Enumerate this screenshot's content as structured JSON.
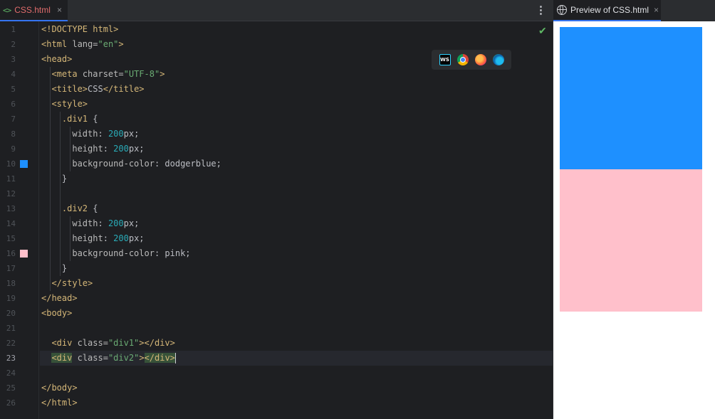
{
  "editor": {
    "tab": {
      "icon": "html-file-icon",
      "icon_glyph": "<>",
      "label": "CSS.html",
      "close": "×"
    },
    "menu_glyph": "⋮",
    "check_glyph": "✔",
    "current_line": 23,
    "lines": [
      {
        "n": "1",
        "code": [
          {
            "t": "<!DOCTYPE ",
            "c": "tag"
          },
          {
            "t": "html",
            "c": "tag"
          },
          {
            "t": ">",
            "c": "tag"
          }
        ]
      },
      {
        "n": "2",
        "code": [
          {
            "t": "<html ",
            "c": "tag"
          },
          {
            "t": "lang",
            "c": "attr"
          },
          {
            "t": "=",
            "c": "attr"
          },
          {
            "t": "\"en\"",
            "c": "str"
          },
          {
            "t": ">",
            "c": "tag"
          }
        ]
      },
      {
        "n": "3",
        "code": [
          {
            "t": "<head>",
            "c": "tag"
          }
        ]
      },
      {
        "n": "4",
        "code": [
          {
            "t": "  "
          },
          {
            "t": "<meta ",
            "c": "tag"
          },
          {
            "t": "charset",
            "c": "attr"
          },
          {
            "t": "=",
            "c": "attr"
          },
          {
            "t": "\"UTF-8\"",
            "c": "str"
          },
          {
            "t": ">",
            "c": "tag"
          }
        ]
      },
      {
        "n": "5",
        "code": [
          {
            "t": "  "
          },
          {
            "t": "<title>",
            "c": "tag"
          },
          {
            "t": "CSS"
          },
          {
            "t": "</title>",
            "c": "tag"
          }
        ]
      },
      {
        "n": "6",
        "code": [
          {
            "t": "  "
          },
          {
            "t": "<style>",
            "c": "tag"
          }
        ]
      },
      {
        "n": "7",
        "code": [
          {
            "t": "    "
          },
          {
            "t": ".div1",
            "c": "sel"
          },
          {
            "t": " {"
          }
        ]
      },
      {
        "n": "8",
        "code": [
          {
            "t": "      "
          },
          {
            "t": "width",
            "c": "prop"
          },
          {
            "t": ": "
          },
          {
            "t": "200",
            "c": "num"
          },
          {
            "t": "px;"
          }
        ]
      },
      {
        "n": "9",
        "code": [
          {
            "t": "      "
          },
          {
            "t": "height",
            "c": "prop"
          },
          {
            "t": ": "
          },
          {
            "t": "200",
            "c": "num"
          },
          {
            "t": "px;"
          }
        ]
      },
      {
        "n": "10",
        "code": [
          {
            "t": "      "
          },
          {
            "t": "background-color",
            "c": "prop"
          },
          {
            "t": ": dodgerblue;"
          }
        ],
        "swatch": "#1e90ff"
      },
      {
        "n": "11",
        "code": [
          {
            "t": "    }"
          }
        ]
      },
      {
        "n": "12",
        "code": []
      },
      {
        "n": "13",
        "code": [
          {
            "t": "    "
          },
          {
            "t": ".div2",
            "c": "sel"
          },
          {
            "t": " {"
          }
        ]
      },
      {
        "n": "14",
        "code": [
          {
            "t": "      "
          },
          {
            "t": "width",
            "c": "prop"
          },
          {
            "t": ": "
          },
          {
            "t": "200",
            "c": "num"
          },
          {
            "t": "px;"
          }
        ]
      },
      {
        "n": "15",
        "code": [
          {
            "t": "      "
          },
          {
            "t": "height",
            "c": "prop"
          },
          {
            "t": ": "
          },
          {
            "t": "200",
            "c": "num"
          },
          {
            "t": "px;"
          }
        ]
      },
      {
        "n": "16",
        "code": [
          {
            "t": "      "
          },
          {
            "t": "background-color",
            "c": "prop"
          },
          {
            "t": ": pink;"
          }
        ],
        "swatch": "#ffc0cb"
      },
      {
        "n": "17",
        "code": [
          {
            "t": "    }"
          }
        ]
      },
      {
        "n": "18",
        "code": [
          {
            "t": "  "
          },
          {
            "t": "</style>",
            "c": "tag"
          }
        ]
      },
      {
        "n": "19",
        "code": [
          {
            "t": "</head>",
            "c": "tag"
          }
        ]
      },
      {
        "n": "20",
        "code": [
          {
            "t": "<body>",
            "c": "tag"
          }
        ]
      },
      {
        "n": "21",
        "code": []
      },
      {
        "n": "22",
        "code": [
          {
            "t": "  "
          },
          {
            "t": "<div ",
            "c": "tag"
          },
          {
            "t": "class",
            "c": "attr"
          },
          {
            "t": "=",
            "c": "attr"
          },
          {
            "t": "\"div1\"",
            "c": "str"
          },
          {
            "t": "></div>",
            "c": "tag"
          }
        ]
      },
      {
        "n": "23",
        "code": [
          {
            "t": "  "
          },
          {
            "t": "<div",
            "c": "tag hl"
          },
          {
            "t": " "
          },
          {
            "t": "class",
            "c": "attr"
          },
          {
            "t": "=",
            "c": "attr"
          },
          {
            "t": "\"div2\"",
            "c": "str"
          },
          {
            "t": ">",
            "c": "tag"
          },
          {
            "t": "</div>",
            "c": "tag hl"
          },
          {
            "caret": true
          }
        ]
      },
      {
        "n": "24",
        "code": []
      },
      {
        "n": "25",
        "code": [
          {
            "t": "</body>",
            "c": "tag"
          }
        ]
      },
      {
        "n": "26",
        "code": [
          {
            "t": "</html>",
            "c": "tag"
          }
        ]
      }
    ],
    "browser_icons": [
      {
        "name": "webstorm-icon",
        "text": "WS"
      },
      {
        "name": "chrome-icon",
        "text": ""
      },
      {
        "name": "firefox-icon",
        "text": ""
      },
      {
        "name": "edge-icon",
        "text": ""
      }
    ]
  },
  "preview": {
    "tab": {
      "icon": "globe-icon",
      "label": "Preview of CSS.html",
      "close": "×"
    },
    "boxes": [
      {
        "name": "div1-box",
        "color": "#1e90ff"
      },
      {
        "name": "div2-box",
        "color": "#ffc0cb"
      }
    ]
  }
}
